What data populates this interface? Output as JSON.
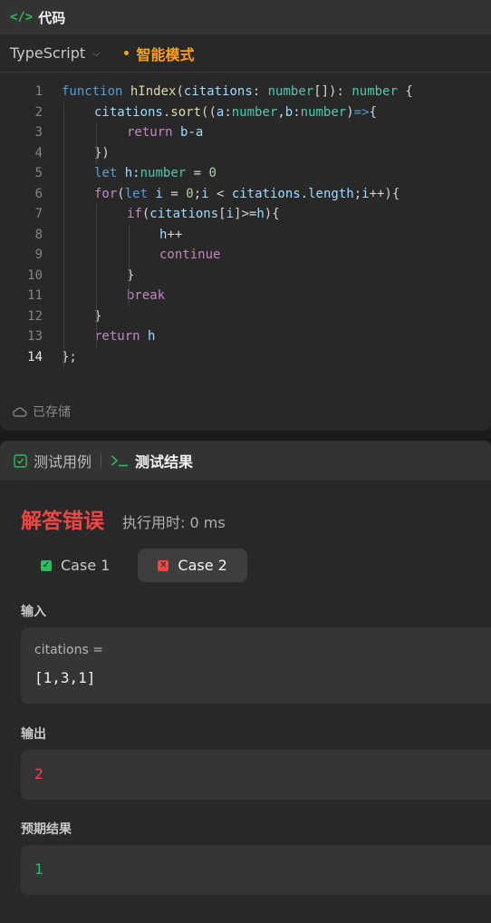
{
  "editor": {
    "title": "代码",
    "language": "TypeScript",
    "mode": "智能模式",
    "saved_status": "已存储",
    "active_line": 14,
    "lines": [
      {
        "n": 1,
        "indent": 0,
        "tokens": [
          [
            "kw",
            "function"
          ],
          [
            "pl",
            " "
          ],
          [
            "fn",
            "hIndex"
          ],
          [
            "pl",
            "("
          ],
          [
            "var",
            "citations"
          ],
          [
            "pl",
            ": "
          ],
          [
            "type",
            "number"
          ],
          [
            "pl",
            "[]): "
          ],
          [
            "type",
            "number"
          ],
          [
            "pl",
            " {"
          ]
        ]
      },
      {
        "n": 2,
        "indent": 1,
        "tokens": [
          [
            "var",
            "citations"
          ],
          [
            "pl",
            "."
          ],
          [
            "fn",
            "sort"
          ],
          [
            "pl",
            "(("
          ],
          [
            "var",
            "a"
          ],
          [
            "pl",
            ":"
          ],
          [
            "type",
            "number"
          ],
          [
            "pl",
            ","
          ],
          [
            "var",
            "b"
          ],
          [
            "pl",
            ":"
          ],
          [
            "type",
            "number"
          ],
          [
            "pl",
            ")"
          ],
          [
            "kw",
            "=>"
          ],
          [
            "pl",
            "{"
          ]
        ]
      },
      {
        "n": 3,
        "indent": 2,
        "tokens": [
          [
            "ctl",
            "return"
          ],
          [
            "pl",
            " "
          ],
          [
            "var",
            "b"
          ],
          [
            "pl",
            "-"
          ],
          [
            "var",
            "a"
          ]
        ]
      },
      {
        "n": 4,
        "indent": 1,
        "tokens": [
          [
            "pl",
            "})"
          ]
        ]
      },
      {
        "n": 5,
        "indent": 1,
        "tokens": [
          [
            "kw",
            "let"
          ],
          [
            "pl",
            " "
          ],
          [
            "var",
            "h"
          ],
          [
            "pl",
            ":"
          ],
          [
            "type",
            "number"
          ],
          [
            "pl",
            " = "
          ],
          [
            "num",
            "0"
          ]
        ]
      },
      {
        "n": 6,
        "indent": 1,
        "tokens": [
          [
            "ctl",
            "for"
          ],
          [
            "pl",
            "("
          ],
          [
            "kw",
            "let"
          ],
          [
            "pl",
            " "
          ],
          [
            "var",
            "i"
          ],
          [
            "pl",
            " = "
          ],
          [
            "num",
            "0"
          ],
          [
            "pl",
            ";"
          ],
          [
            "var",
            "i"
          ],
          [
            "pl",
            " < "
          ],
          [
            "var",
            "citations"
          ],
          [
            "pl",
            "."
          ],
          [
            "var",
            "length"
          ],
          [
            "pl",
            ";"
          ],
          [
            "var",
            "i"
          ],
          [
            "pl",
            "++){"
          ]
        ]
      },
      {
        "n": 7,
        "indent": 2,
        "tokens": [
          [
            "ctl",
            "if"
          ],
          [
            "pl",
            "("
          ],
          [
            "var",
            "citations"
          ],
          [
            "pl",
            "["
          ],
          [
            "var",
            "i"
          ],
          [
            "pl",
            "]>="
          ],
          [
            "var",
            "h"
          ],
          [
            "pl",
            "){"
          ]
        ]
      },
      {
        "n": 8,
        "indent": 3,
        "tokens": [
          [
            "var",
            "h"
          ],
          [
            "pl",
            "++"
          ]
        ]
      },
      {
        "n": 9,
        "indent": 3,
        "tokens": [
          [
            "ctl",
            "continue"
          ]
        ]
      },
      {
        "n": 10,
        "indent": 2,
        "tokens": [
          [
            "pl",
            "}"
          ]
        ]
      },
      {
        "n": 11,
        "indent": 2,
        "tokens": [
          [
            "ctl",
            "break"
          ]
        ]
      },
      {
        "n": 12,
        "indent": 1,
        "tokens": [
          [
            "pl",
            "}"
          ]
        ]
      },
      {
        "n": 13,
        "indent": 1,
        "tokens": [
          [
            "ctl",
            "return"
          ],
          [
            "pl",
            " "
          ],
          [
            "var",
            "h"
          ]
        ]
      },
      {
        "n": 14,
        "indent": 0,
        "tokens": [
          [
            "pl",
            "};"
          ]
        ]
      }
    ]
  },
  "result": {
    "tab_testcases": "测试用例",
    "tab_result": "测试结果",
    "verdict": "解答错误",
    "runtime": "执行用时: 0 ms",
    "cases": [
      {
        "label": "Case 1",
        "status": "pass",
        "active": false
      },
      {
        "label": "Case 2",
        "status": "fail",
        "active": true
      }
    ],
    "input_label": "输入",
    "input_var": "citations =",
    "input_value": "[1,3,1]",
    "output_label": "输出",
    "output_value": "2",
    "expected_label": "预期结果",
    "expected_value": "1"
  },
  "colors": {
    "accent_green": "#2cbb5d",
    "accent_orange": "#ffa116",
    "error_red": "#ef4743"
  }
}
